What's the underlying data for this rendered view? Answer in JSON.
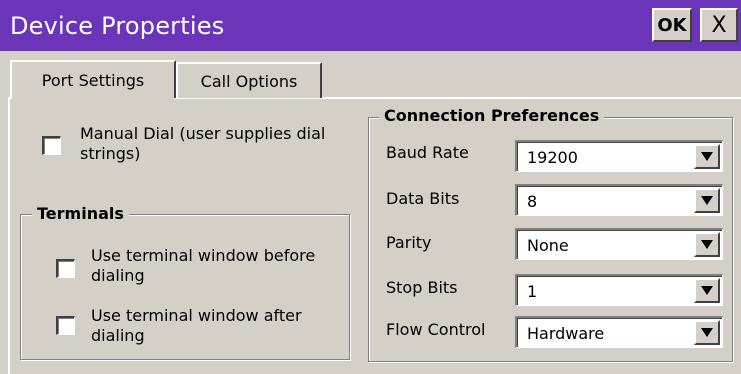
{
  "window": {
    "title": "Device Properties",
    "ok_label": "OK",
    "close_label": "X"
  },
  "tabs": [
    {
      "label": "Port Settings",
      "active": true
    },
    {
      "label": "Call Options",
      "active": false
    }
  ],
  "manual_dial": {
    "line1": "Manual Dial (user supplies dial",
    "line2": "strings)",
    "checked": false
  },
  "terminals": {
    "title": "Terminals",
    "before": {
      "line1": "Use terminal window before",
      "line2": "dialing",
      "checked": false
    },
    "after": {
      "line1": "Use terminal window after",
      "line2": "dialing",
      "checked": false
    }
  },
  "connection": {
    "title": "Connection Preferences",
    "fields": [
      {
        "label": "Baud Rate",
        "value": "19200"
      },
      {
        "label": "Data Bits",
        "value": "8"
      },
      {
        "label": "Parity",
        "value": "None"
      },
      {
        "label": "Stop Bits",
        "value": "1"
      },
      {
        "label": "Flow Control",
        "value": "Hardware"
      }
    ]
  },
  "colors": {
    "titlebar": "#6a35b8",
    "face": "#d4d0c8"
  }
}
